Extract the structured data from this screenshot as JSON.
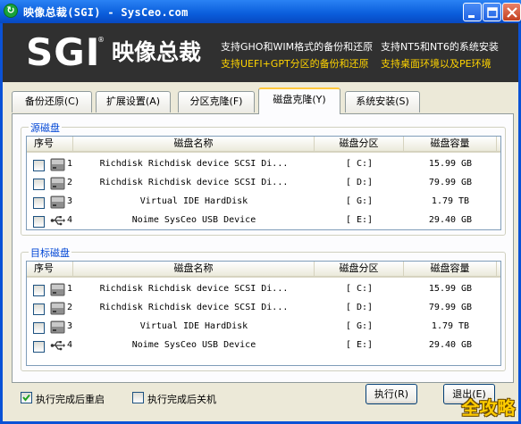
{
  "window": {
    "title": "映像总裁(SGI) - SysCeo.com",
    "icon": "refresh-icon"
  },
  "banner": {
    "logo_text": "SGI",
    "logo_mark": "®",
    "logo_cn": "映像总裁",
    "features": [
      "支持GHO和WIM格式的备份和还原",
      "支持NT5和NT6的系统安装",
      "支持UEFI+GPT分区的备份和还原",
      "支持桌面环境以及PE环境"
    ],
    "feature_colors": {
      "white": "#ffffff",
      "yellow": "#ffd400"
    }
  },
  "tabs": [
    {
      "label": "备份还原(C)",
      "active": false
    },
    {
      "label": "扩展设置(A)",
      "active": false
    },
    {
      "label": "分区克隆(F)",
      "active": false
    },
    {
      "label": "磁盘克隆(Y)",
      "active": true
    },
    {
      "label": "系统安装(S)",
      "active": false
    }
  ],
  "columns": [
    "序号",
    "磁盘名称",
    "磁盘分区",
    "磁盘容量"
  ],
  "source": {
    "title": "源磁盘",
    "rows": [
      {
        "num": "1",
        "icon": "hard-disk-icon",
        "name": "Richdisk Richdisk  device SCSI Di...",
        "partition": "[ C:]",
        "capacity": "15.99 GB"
      },
      {
        "num": "2",
        "icon": "hard-disk-icon",
        "name": "Richdisk Richdisk  device SCSI Di...",
        "partition": "[ D:]",
        "capacity": "79.99 GB"
      },
      {
        "num": "3",
        "icon": "hard-disk-icon",
        "name": "Virtual IDE HardDisk",
        "partition": "[ G:]",
        "capacity": "1.79 TB"
      },
      {
        "num": "4",
        "icon": "usb-icon",
        "name": "Noime SysCeo USB Device",
        "partition": "[ E:]",
        "capacity": "29.40 GB"
      }
    ]
  },
  "target": {
    "title": "目标磁盘",
    "rows": [
      {
        "num": "1",
        "icon": "hard-disk-icon",
        "name": "Richdisk Richdisk  device SCSI Di...",
        "partition": "[ C:]",
        "capacity": "15.99 GB"
      },
      {
        "num": "2",
        "icon": "hard-disk-icon",
        "name": "Richdisk Richdisk  device SCSI Di...",
        "partition": "[ D:]",
        "capacity": "79.99 GB"
      },
      {
        "num": "3",
        "icon": "hard-disk-icon",
        "name": "Virtual IDE HardDisk",
        "partition": "[ G:]",
        "capacity": "1.79 TB"
      },
      {
        "num": "4",
        "icon": "usb-icon",
        "name": "Noime SysCeo USB Device",
        "partition": "[ E:]",
        "capacity": "29.40 GB"
      }
    ]
  },
  "options": {
    "reboot_label": "执行完成后重启",
    "reboot_checked": true,
    "shutdown_label": "执行完成后关机",
    "shutdown_checked": false
  },
  "buttons": {
    "execute": "执行(R)",
    "exit": "退出(E)"
  },
  "watermark": "全攻略"
}
